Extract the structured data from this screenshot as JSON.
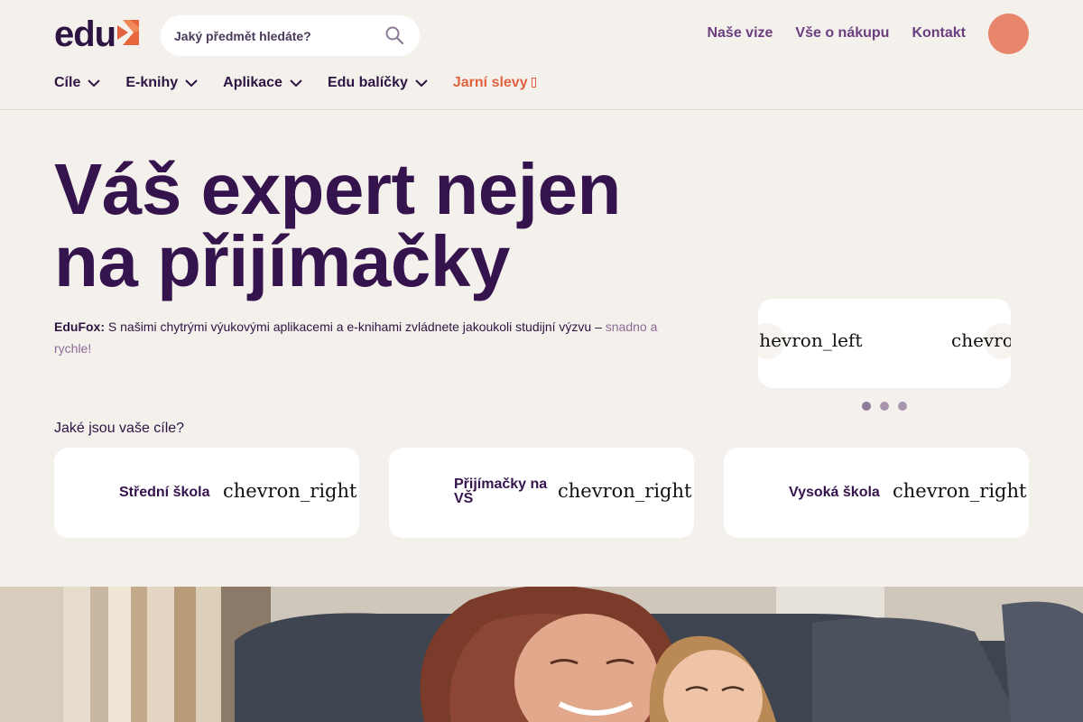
{
  "header": {
    "logo_text": "edu",
    "search": {
      "placeholder": "Jaký předmět hledáte?",
      "icon": "search-icon"
    },
    "top_links": [
      "Naše vize",
      "Vše o nákupu",
      "Kontakt"
    ],
    "avatar_color": "#e8866c"
  },
  "nav": {
    "items": [
      "Cíle",
      "E-knihy",
      "Aplikace",
      "Edu balíčky"
    ],
    "promo": "Jarní slevy",
    "promo_color": "#e0623f"
  },
  "hero": {
    "title_line1": "Váš expert nejen",
    "title_line2": "na přijímačky",
    "brand": "EduFox:",
    "text": "S našimi chytrými výukovými aplikacemi a e-knihami zvládnete jakoukoli studijní výzvu –",
    "highlight": "snadno a rychle!"
  },
  "carousel": {
    "prev_label": "chevron_left",
    "next_label": "chevron_right",
    "dots": 3
  },
  "goals": {
    "heading": "Jaké jsou vaše cíle?",
    "cards": [
      {
        "label": "Střední škola",
        "icon_label": "chevron_right"
      },
      {
        "label": "Přijímačky na VŠ",
        "icon_label": "chevron_right"
      },
      {
        "label": "Vysoká škola",
        "icon_label": "chevron_right"
      }
    ]
  },
  "colors": {
    "background": "#f4f1ec",
    "primary": "#35134d",
    "accent": "#e0623f",
    "link": "#6b3e7f"
  }
}
